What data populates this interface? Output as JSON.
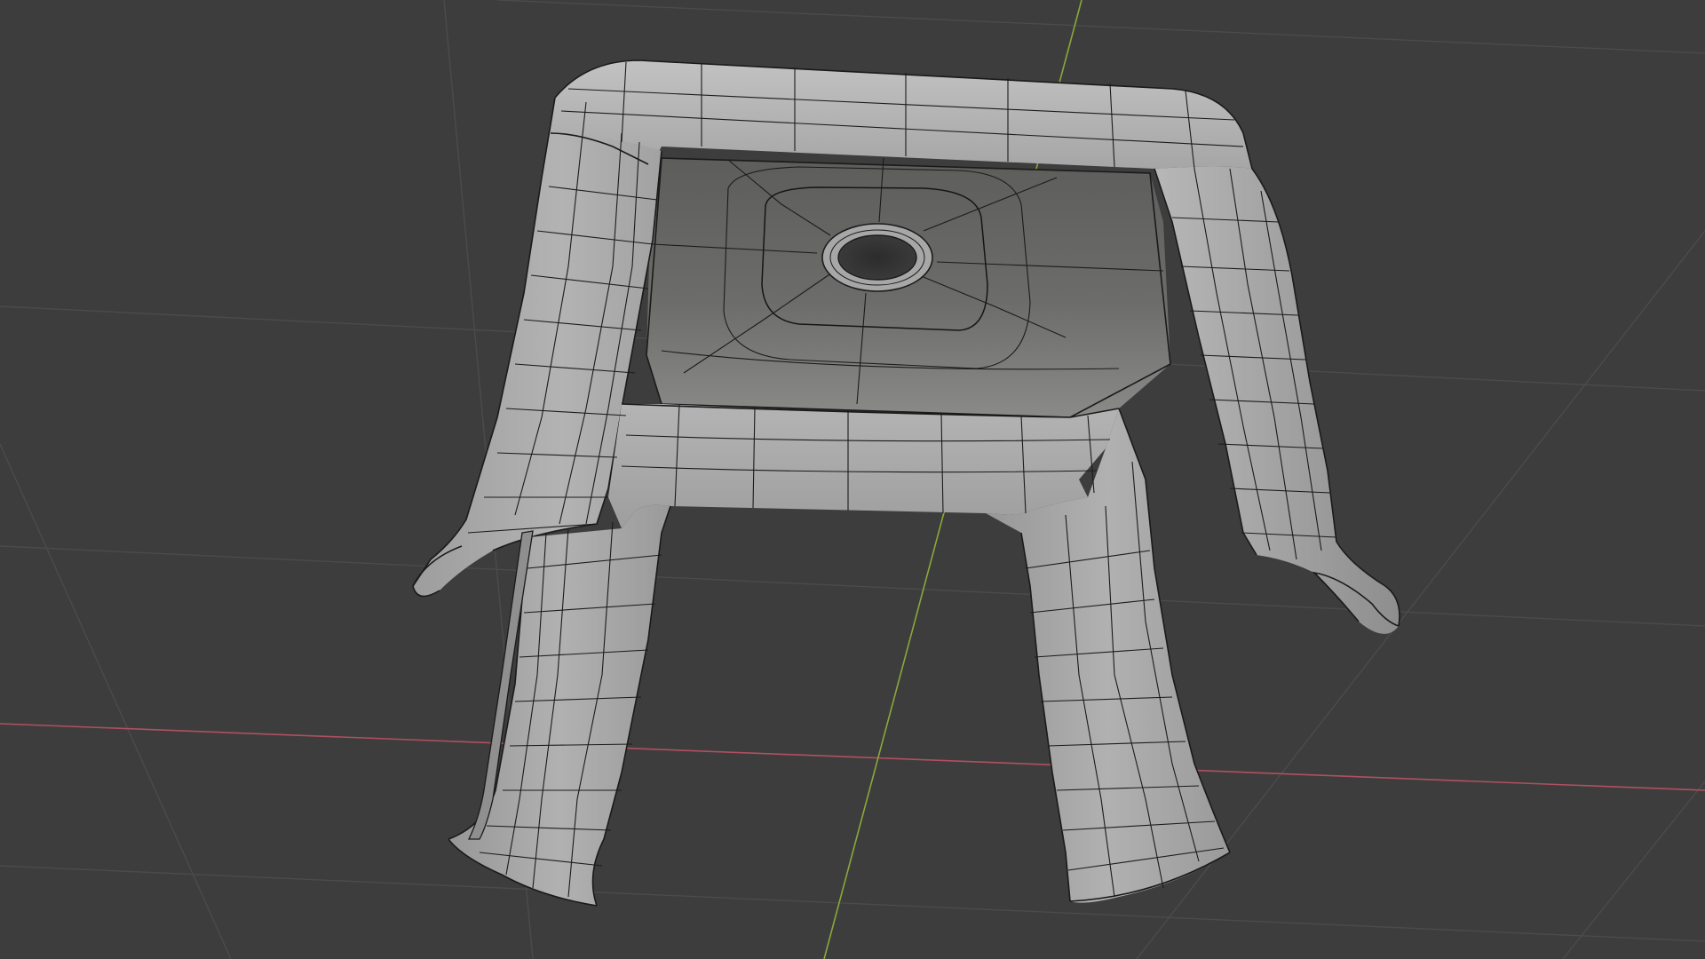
{
  "viewport": {
    "background": "#3d3d3d",
    "grid_color": "#4b4b4b",
    "x_axis_color": "#b05060",
    "y_axis_color": "#8aa83a",
    "mesh_color": "#a9a9a9",
    "mesh_shadow_color": "#8c8c8c",
    "interior_color": "#6a6a68",
    "wire_color": "#1b1b1b",
    "object": "stool-mesh",
    "shading": "solid",
    "overlay": "wireframe"
  }
}
